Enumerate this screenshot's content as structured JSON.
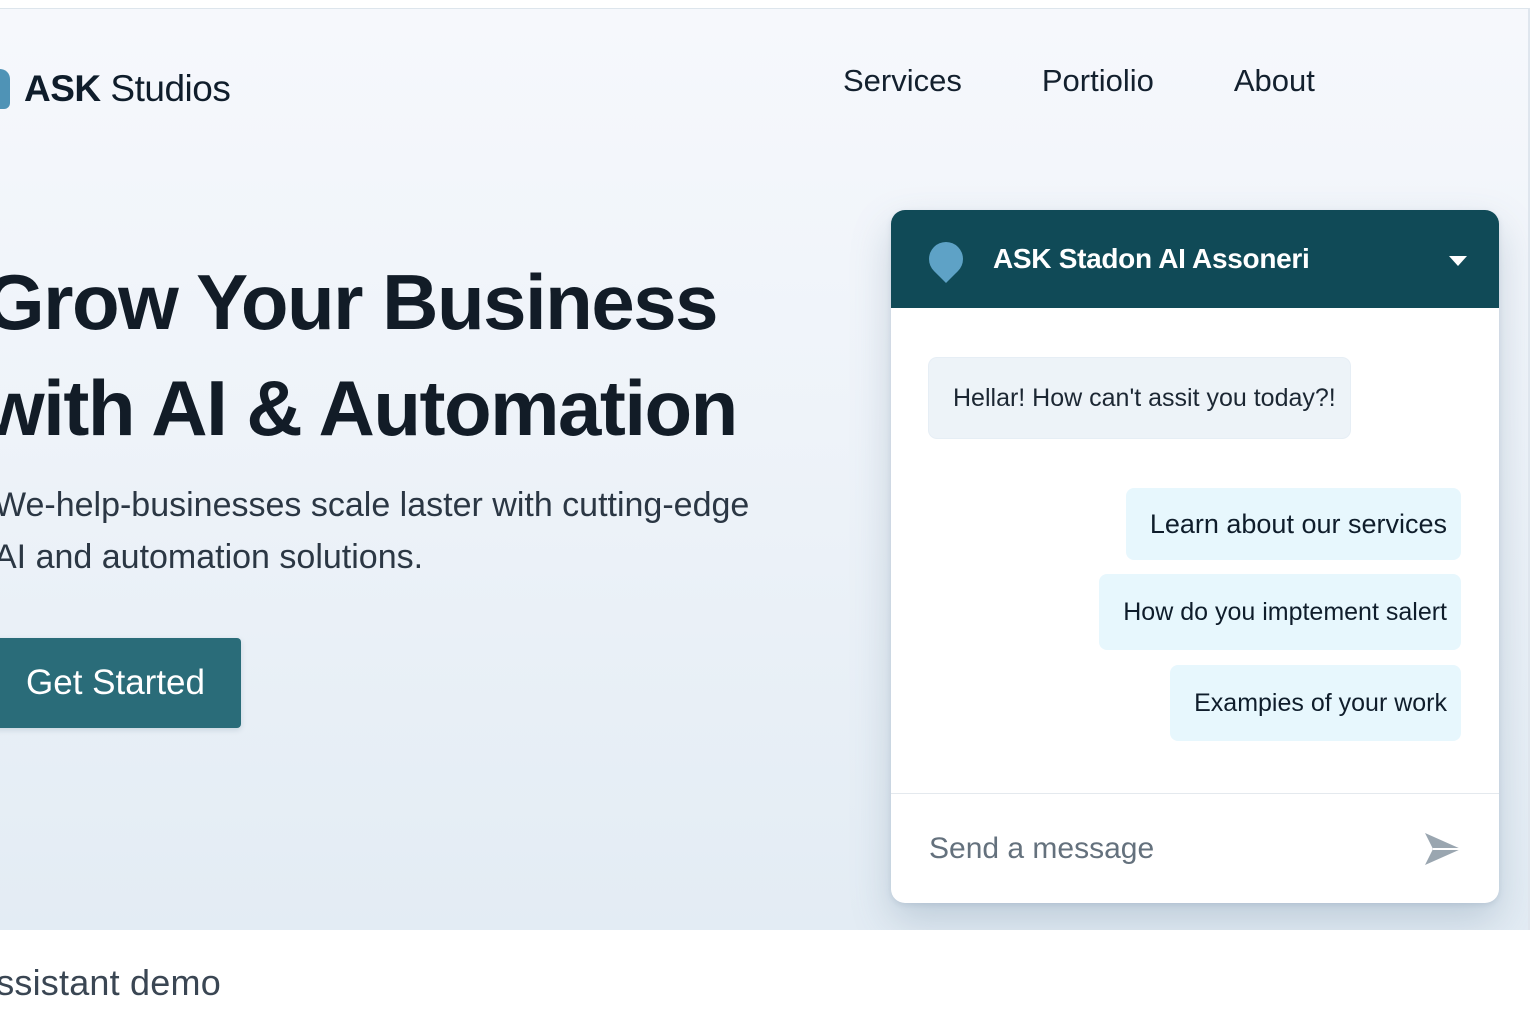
{
  "brand": {
    "name_bold": "ASK",
    "name_rest": " Studios"
  },
  "nav": {
    "items": [
      "Services",
      "Portiolio",
      "About"
    ]
  },
  "hero": {
    "title_line1": "Grow Your Business",
    "title_line2": "with AI & Automation",
    "subtitle_line1": "We-help-businesses scale laster with cutting-edge",
    "subtitle_line2": "AI and automation solutions.",
    "cta_label": "Get Started"
  },
  "chat": {
    "title": "ASK Stadon AI Assoneri",
    "bot_message": "Hellar! How can't assit you today?!",
    "options": [
      "Learn about our services",
      "How do you imptement salert",
      "Exampies of your work"
    ],
    "input_placeholder": "Send a message"
  },
  "caption": "Assistant demo",
  "colors": {
    "header": "#104a57",
    "cta": "#2a6c79",
    "option_bg": "#e7f7fd",
    "accent": "#5ea2c6"
  },
  "icons": {
    "logo": "logo-icon",
    "chat_header": "location-pin-icon",
    "collapse": "chevron-down-icon",
    "send": "send-icon"
  }
}
